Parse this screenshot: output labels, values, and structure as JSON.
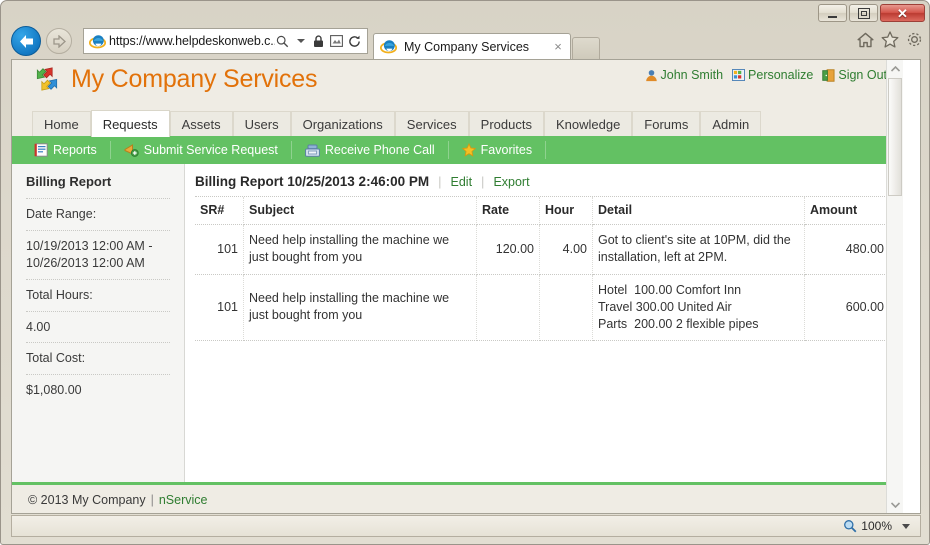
{
  "browser": {
    "window_controls": {
      "minimize": "Minimize",
      "restore": "Restore",
      "close": "Close"
    },
    "back_button": "Back",
    "forward_button": "Forward",
    "address_value": "https://www.helpdeskonweb.c...",
    "address_icons": [
      "search-icon",
      "dropdown-caret-icon",
      "lock-icon",
      "compatibility-view-icon",
      "refresh-icon"
    ],
    "tab_title": "My Company Services",
    "tab_close": "×",
    "command_icons": [
      "home-icon",
      "favorites-star-icon",
      "tools-gear-icon"
    ]
  },
  "app": {
    "brand_title": "My Company Services",
    "user_links": [
      {
        "label": "John Smith",
        "icon": "user-icon"
      },
      {
        "label": "Personalize",
        "icon": "personalize-grid-icon"
      },
      {
        "label": "Sign Out",
        "icon": "sign-out-door-icon"
      }
    ],
    "nav_tabs": [
      {
        "label": "Home",
        "active": false
      },
      {
        "label": "Requests",
        "active": true
      },
      {
        "label": "Assets",
        "active": false
      },
      {
        "label": "Users",
        "active": false
      },
      {
        "label": "Organizations",
        "active": false
      },
      {
        "label": "Services",
        "active": false
      },
      {
        "label": "Products",
        "active": false
      },
      {
        "label": "Knowledge",
        "active": false
      },
      {
        "label": "Forums",
        "active": false
      },
      {
        "label": "Admin",
        "active": false
      }
    ],
    "toolbar": [
      {
        "label": "Reports",
        "icon": "report-notebook-icon"
      },
      {
        "label": "Submit Service Request",
        "icon": "submit-request-icon"
      },
      {
        "label": "Receive Phone Call",
        "icon": "phone-icon"
      },
      {
        "label": "Favorites",
        "icon": "star-icon"
      }
    ],
    "accent_green": "#63c163",
    "brand_orange": "#e2720a",
    "link_green": "#2f7d31"
  },
  "sidebar": {
    "title": "Billing Report",
    "rows": [
      {
        "label": "Date Range:",
        "value": "10/19/2013 12:00 AM - 10/26/2013 12:00 AM"
      },
      {
        "label": "Total Hours:",
        "value": "4.00"
      },
      {
        "label": "Total Cost:",
        "value": "$1,080.00"
      }
    ]
  },
  "content": {
    "heading": "Billing Report 10/25/2013 2:46:00 PM",
    "edit_label": "Edit",
    "export_label": "Export",
    "table": {
      "headers": [
        "SR#",
        "Subject",
        "Rate",
        "Hour",
        "Detail",
        "Amount"
      ],
      "rows": [
        {
          "sr": "101",
          "subject": "Need help installing the machine we just bought from you",
          "rate": "120.00",
          "hour": "4.00",
          "detail": "Got to client's site at 10PM, did the installation, left at 2PM.",
          "detail_lines": [
            "Got to client's site at 10PM, did the",
            "installation, left at 2PM."
          ],
          "amount": "480.00"
        },
        {
          "sr": "101",
          "subject": "Need help installing the machine we just bought from you",
          "rate": "",
          "hour": "",
          "detail": "Hotel  100.00 Comfort Inn\nTravel 300.00 United Air\nParts  200.00 2 flexible pipes",
          "detail_lines": [
            "Hotel  100.00 Comfort Inn",
            "Travel 300.00 United Air",
            "Parts  200.00 2 flexible pipes"
          ],
          "amount": "600.00"
        }
      ]
    }
  },
  "footer": {
    "copyright": "© 2013 My Company",
    "divider": "|",
    "link": "nService"
  },
  "statusbar": {
    "zoom_level": "100%",
    "zoom_icon": "zoom-magnifier-icon"
  }
}
